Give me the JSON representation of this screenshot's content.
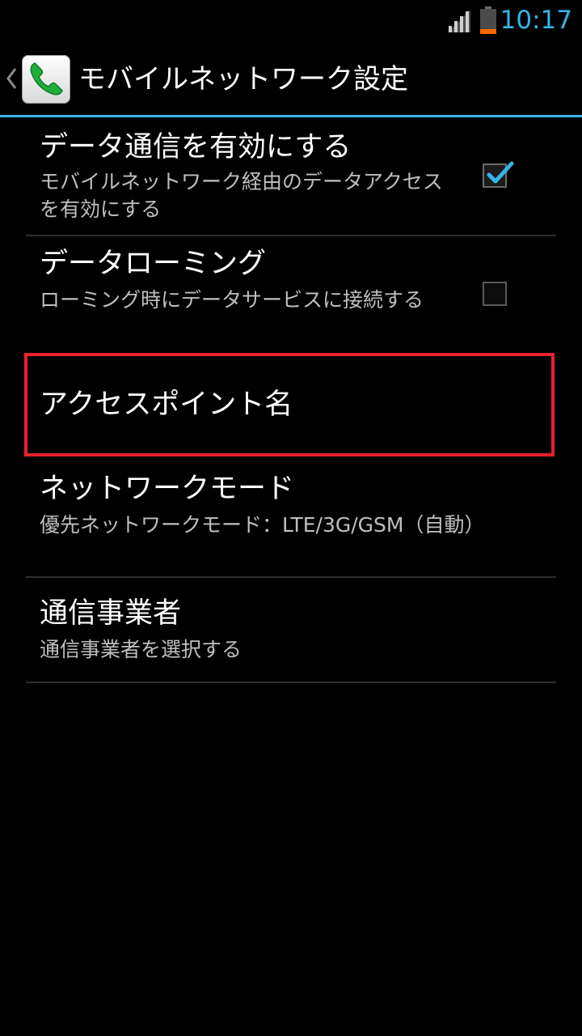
{
  "status_bar": {
    "time": "10:17",
    "icons": [
      "signal-icon",
      "battery-icon"
    ],
    "clock_color": "#33b5e5",
    "battery_low_color": "#ff6600"
  },
  "action_bar": {
    "title": "モバイルネットワーク設定",
    "icons": [
      "up-indicator-icon",
      "phone-app-icon"
    ],
    "accent_color": "#33b5e5"
  },
  "preferences": [
    {
      "title": "データ通信を有効にする",
      "summary": "モバイルネットワーク経由のデータアクセスを有効にする",
      "checkbox": true,
      "checked": true
    },
    {
      "title": "データローミング",
      "summary": "ローミング時にデータサービスに接続する",
      "checkbox": true,
      "checked": false
    },
    {
      "title": "アクセスポイント名",
      "summary": "",
      "checkbox": false,
      "highlighted": true
    },
    {
      "title": "ネットワークモード",
      "summary": "優先ネットワークモード：LTE/3G/GSM（自動）",
      "checkbox": false
    },
    {
      "title": "通信事業者",
      "summary": "通信事業者を選択する",
      "checkbox": false
    }
  ],
  "highlight_color": "#e8202f"
}
